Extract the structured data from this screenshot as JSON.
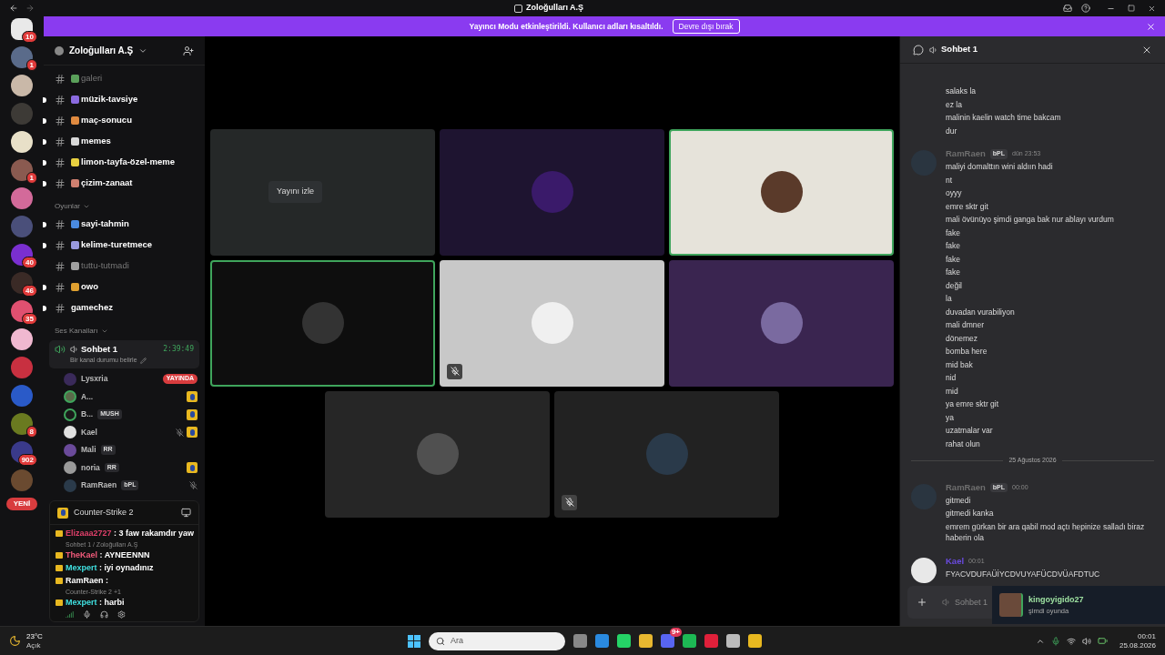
{
  "window": {
    "title": "Zoloğulları A.Ş"
  },
  "banner": {
    "text": "Yayıncı Modu etkinleştirildi. Kullanıcı adları kısaltıldı.",
    "button": "Devre dışı bırak"
  },
  "servers": [
    {
      "badge": "10",
      "home": true
    },
    {
      "badge": "1",
      "home": false
    },
    {
      "home": false
    },
    {
      "home": false
    },
    {
      "home": false
    },
    {
      "badge": "1",
      "home": false
    },
    {
      "home": false
    },
    {
      "home": false
    },
    {
      "badge": "40",
      "home": false
    },
    {
      "badge": "46",
      "home": false
    },
    {
      "badge": "35",
      "home": false
    },
    {
      "home": false
    },
    {
      "home": false
    },
    {
      "home": false
    },
    {
      "badge": "8",
      "home": false
    },
    {
      "badge": "902",
      "home": false
    },
    {
      "home": false
    }
  ],
  "new_button": "YENİ",
  "server": {
    "name": "Zoloğulları A.Ş"
  },
  "channel_groups": [
    {
      "channels": [
        {
          "name": "galeri",
          "color": "#5aa05a",
          "unread": false
        },
        {
          "name": "müzik-tavsiye",
          "color": "#8a6ae0",
          "unread": true
        },
        {
          "name": "maç-sonucu",
          "color": "#e08a40",
          "unread": true
        },
        {
          "name": "memes",
          "color": "#d8d8d8",
          "unread": true
        },
        {
          "name": "limon-tayfa-özel-meme",
          "color": "#e8d040",
          "unread": true
        },
        {
          "name": "çizim-zanaat",
          "color": "#d08070",
          "unread": true
        }
      ]
    },
    {
      "title": "Oyunlar",
      "channels": [
        {
          "name": "sayi-tahmin",
          "color": "#4a8ae0",
          "unread": true
        },
        {
          "name": "kelime-turetmece",
          "color": "#9a9ae0",
          "unread": true
        },
        {
          "name": "tuttu-tutmadi",
          "color": "#a0a0a0",
          "unread": false
        },
        {
          "name": "owo",
          "color": "#e0a030",
          "unread": true
        },
        {
          "name": "gamechez",
          "unread": true
        }
      ]
    }
  ],
  "voice": {
    "category": "Ses Kanalları",
    "channel": "Sohbet 1",
    "timer": "2:39:49",
    "status": "Bir kanal durumu belirle",
    "members": [
      {
        "name": "Lysxria",
        "live": "YAYINDA",
        "speaking": false,
        "muted": false,
        "game": false
      },
      {
        "name": "A...",
        "speaking": true,
        "muted": false,
        "game": true
      },
      {
        "name": "B...",
        "tag": "MUSH",
        "speaking": true,
        "muted": false,
        "game": true
      },
      {
        "name": "Kael",
        "speaking": false,
        "muted": true,
        "game": true
      },
      {
        "name": "Mali",
        "tag": "RR",
        "speaking": false,
        "muted": false,
        "game": false
      },
      {
        "name": "noria",
        "tag": "RR",
        "speaking": false,
        "muted": false,
        "game": true
      },
      {
        "name": "RamRaen",
        "tag": "bPL",
        "speaking": false,
        "muted": true,
        "game": false
      }
    ]
  },
  "activity": {
    "game": "Counter-Strike 2"
  },
  "overlay_chat": [
    {
      "kind": "message",
      "author": "Elizaaa2727",
      "color": "#e0406a",
      "text": ": 3 faw rakamdır yaw"
    },
    {
      "kind": "note",
      "text": "Sohbet 1 / Zoloğulları A.Ş"
    },
    {
      "kind": "message",
      "author": "TheKael",
      "color": "#f05a7a",
      "text": ": AYNEENNN"
    },
    {
      "kind": "message",
      "author": "Mexpert",
      "color": "#40e0e0",
      "text": ": iyi oynadınız"
    },
    {
      "kind": "message",
      "author": "RamRaen",
      "color": "#ffffff",
      "text": ":"
    },
    {
      "kind": "note",
      "text": "Counter-Strike 2 +1"
    },
    {
      "kind": "message",
      "author": "Mexpert",
      "color": "#40e0e0",
      "text": ": harbi"
    }
  ],
  "stage": {
    "watch_button": "Yayını izle",
    "tiles": [
      {
        "speaking": false,
        "muted": false,
        "watch": true
      },
      {
        "speaking": false,
        "muted": false,
        "watch": false
      },
      {
        "speaking": true,
        "muted": false,
        "watch": false
      },
      {
        "speaking": true,
        "muted": false,
        "watch": false
      },
      {
        "speaking": false,
        "muted": true,
        "watch": false
      },
      {
        "speaking": false,
        "muted": false,
        "watch": false
      },
      {
        "speaking": false,
        "muted": false,
        "watch": false
      },
      {
        "speaking": false,
        "muted": true,
        "watch": false
      }
    ]
  },
  "chat": {
    "title": "Sohbet 1",
    "placeholder": "Sohbet 1",
    "items": [
      {
        "kind": "group",
        "lines": [
          "salaks la",
          "ez la",
          "malinin kaelin watch time bakcam",
          "dur"
        ]
      },
      {
        "kind": "group",
        "author": "RamRaen",
        "color": "#6e6e6e",
        "tag": "bPL",
        "time": "dün 23:53",
        "lines": [
          "maliyi domalttın wini aldıın hadi",
          "nt",
          "oyyy",
          "emre sktr git",
          "mali övünüyo şimdi ganga bak nur ablayı vurdum",
          "fake",
          "fake",
          "fake",
          "fake",
          "değil",
          "la",
          "duvadan vurabiliyon",
          "mali dmner",
          "dönemez",
          "bomba here",
          "mid bak",
          "nid",
          "mid",
          "ya emre sktr git",
          "ya",
          "uzatmalar var",
          "rahat olun"
        ]
      },
      {
        "kind": "divider",
        "text": "25 Ağustos 2026"
      },
      {
        "kind": "group",
        "author": "RamRaen",
        "color": "#6e6e6e",
        "tag": "bPL",
        "time": "00:00",
        "lines": [
          "gitmedi",
          "gitmedi kanka",
          "emrem gürkan bir ara qabil mod açtı hepinize salladı biraz haberin ola"
        ]
      },
      {
        "kind": "group",
        "author": "Kael",
        "color": "#6a4ae0",
        "time": "00:01",
        "lines": [
          "FYACVDUFAÜİYCDVUYAFÜCDVÜAFDTUC"
        ]
      }
    ]
  },
  "toast": {
    "name": "kingoyigido27",
    "status": "şimdi oyunda"
  },
  "taskbar": {
    "temp": "23°C",
    "weather": "Açık",
    "search": "Ara",
    "discord_badge": "9+",
    "time": "00:01",
    "date": "25.08.2026"
  }
}
